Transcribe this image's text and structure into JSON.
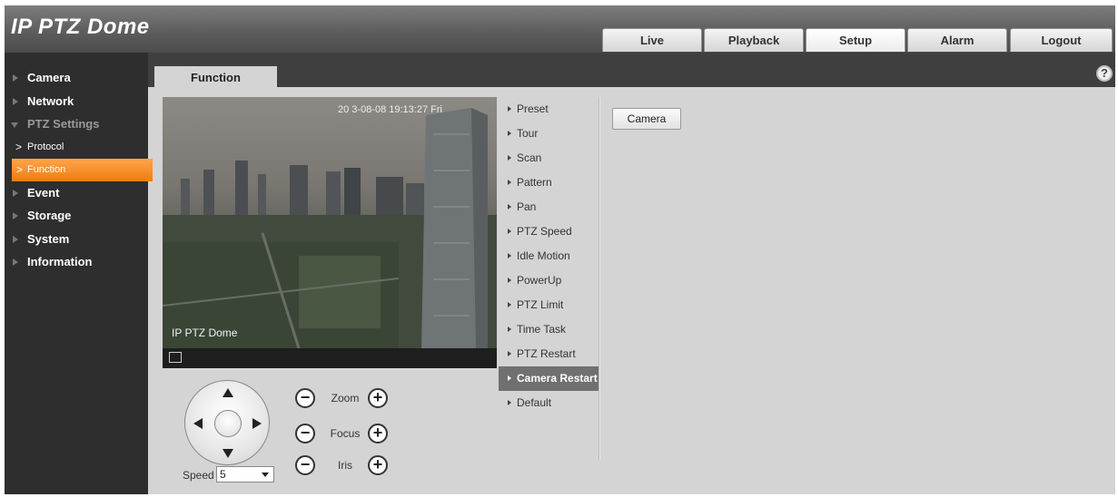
{
  "app": {
    "title": "IP PTZ Dome"
  },
  "nav": {
    "tabs": [
      {
        "label": "Live"
      },
      {
        "label": "Playback"
      },
      {
        "label": "Setup"
      },
      {
        "label": "Alarm"
      },
      {
        "label": "Logout"
      }
    ],
    "active": "Setup"
  },
  "sidebar": {
    "items": [
      {
        "label": "Camera"
      },
      {
        "label": "Network"
      },
      {
        "label": "PTZ Settings"
      },
      {
        "label": "Protocol"
      },
      {
        "label": "Function"
      },
      {
        "label": "Event"
      },
      {
        "label": "Storage"
      },
      {
        "label": "System"
      },
      {
        "label": "Information"
      }
    ],
    "active": "Function"
  },
  "content_tab": {
    "label": "Function"
  },
  "help": {
    "icon": "help-icon",
    "glyph": "?"
  },
  "video": {
    "osd_time": "20  3-08-08  19:13:27 Fri",
    "osd_name": "IP PTZ Dome",
    "fullscreen_icon": "fullscreen-icon"
  },
  "function_menu": {
    "items": [
      {
        "label": "Preset"
      },
      {
        "label": "Tour"
      },
      {
        "label": "Scan"
      },
      {
        "label": "Pattern"
      },
      {
        "label": "Pan"
      },
      {
        "label": "PTZ Speed"
      },
      {
        "label": "Idle Motion"
      },
      {
        "label": "PowerUp"
      },
      {
        "label": "PTZ Limit"
      },
      {
        "label": "Time Task"
      },
      {
        "label": "PTZ Restart"
      },
      {
        "label": "Camera Restart"
      },
      {
        "label": "Default"
      }
    ],
    "active": "Camera Restart"
  },
  "panel": {
    "camera_button": "Camera"
  },
  "ptz": {
    "speed_label": "Speed",
    "speed_value": "5",
    "zoom_label": "Zoom",
    "focus_label": "Focus",
    "iris_label": "Iris",
    "minus": "−",
    "plus": "+"
  },
  "colors": {
    "accent": "#f7931e",
    "sidebar_bg": "#2e2e2e",
    "content_bg": "#d4d4d4",
    "active_menu": "#707070"
  }
}
